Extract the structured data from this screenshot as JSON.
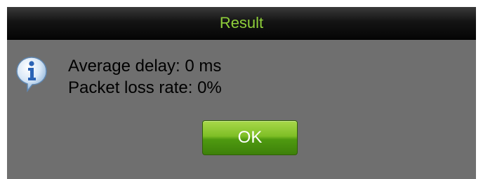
{
  "dialog": {
    "title": "Result",
    "icon": "info-icon",
    "lines": [
      "Average delay: 0 ms",
      "Packet loss rate: 0%"
    ],
    "ok_label": "OK"
  },
  "colors": {
    "title_text": "#8fcf3a",
    "background": "#6f6f6f",
    "titlebar": "#0a0a0a",
    "ok_button": "#6fb020"
  }
}
